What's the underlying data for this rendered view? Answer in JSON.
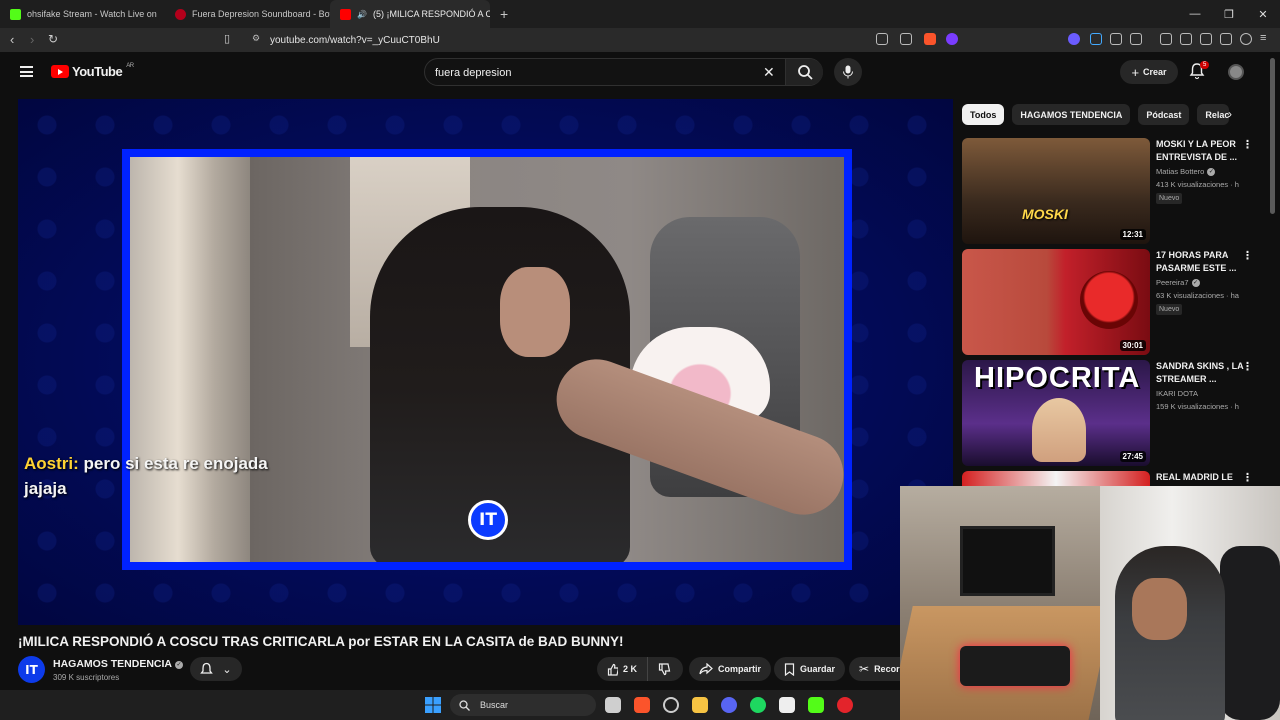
{
  "browser": {
    "tabs": [
      {
        "title": "ohsifake Stream - Watch Live on",
        "favicon_color": "#53fc18"
      },
      {
        "title": "Fuera Depresion Soundboard - Boto",
        "favicon_color": "#b3001b"
      },
      {
        "title": "(5) ¡MILICA RESPONDIÓ A CO",
        "favicon_color": "#ff0000"
      }
    ],
    "url": "youtube.com/watch?v=_yCuuCT0BhU",
    "window_controls": [
      "—",
      "❐",
      "✕"
    ]
  },
  "youtube": {
    "logo_text": "YouTube",
    "region": "AR",
    "search_value": "fuera depresion",
    "create_label": "Crear",
    "notification_count": "5"
  },
  "video": {
    "chat_user": "Aostri:",
    "chat_message": "pero si esta re enojada jajaja",
    "logo_letters": "IT",
    "title": "¡MILICA RESPONDIÓ A COSCU TRAS CRITICARLA por ESTAR EN LA CASITA de BAD BUNNY!"
  },
  "channel": {
    "name": "HAGAMOS TENDENCIA",
    "subscribers": "309 K suscriptores",
    "avatar_letters": "IT"
  },
  "actions": {
    "likes": "2 K",
    "share": "Compartir",
    "save": "Guardar",
    "clip": "Recor"
  },
  "chips": [
    "Todos",
    "HAGAMOS TENDENCIA",
    "Pódcast",
    "Relac"
  ],
  "recommendations": [
    {
      "title": "MOSKI Y LA PEOR ENTREVISTA DE ...",
      "channel": "Matias Bottero",
      "views": "413 K visualizaciones · h",
      "badge": "Nuevo",
      "duration": "12:31",
      "thumb_text": "MOSKI"
    },
    {
      "title": "17 HORAS PARA PASARME ESTE ...",
      "channel": "Peereira7",
      "views": "63 K visualizaciones · ha",
      "badge": "Nuevo",
      "duration": "30:01",
      "thumb_text": ""
    },
    {
      "title": "SANDRA SKINS , LA STREAMER ...",
      "channel": "IKARI DOTA",
      "views": "159 K visualizaciones · h",
      "badge": "",
      "duration": "27:45",
      "thumb_text": "HIPOCRITA"
    },
    {
      "title": "REAL MADRID LE",
      "channel": "",
      "views": "",
      "badge": "",
      "duration": "",
      "thumb_text": ""
    }
  ],
  "taskbar": {
    "search_label": "Buscar"
  },
  "colors": {
    "frame_blue": "#0022ff",
    "yt_red": "#ff0000",
    "chat_user": "#ffd233"
  }
}
